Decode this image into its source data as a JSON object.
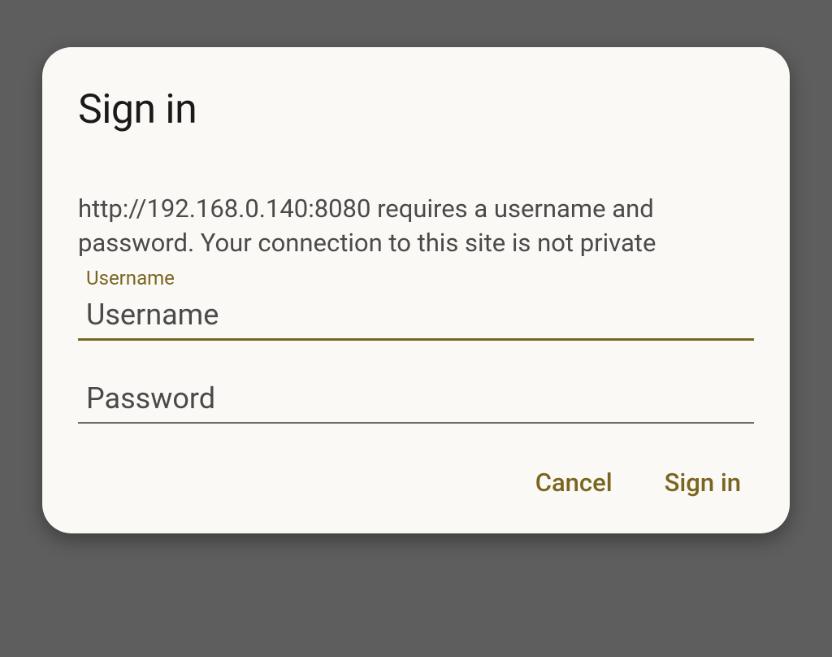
{
  "dialog": {
    "title": "Sign in",
    "message": "http://192.168.0.140:8080 requires a username and password. Your connection to this site is not private",
    "username": {
      "label": "Username",
      "placeholder": "Username",
      "value": ""
    },
    "password": {
      "placeholder": "Password",
      "value": ""
    },
    "actions": {
      "cancel": "Cancel",
      "signin": "Sign in"
    }
  }
}
